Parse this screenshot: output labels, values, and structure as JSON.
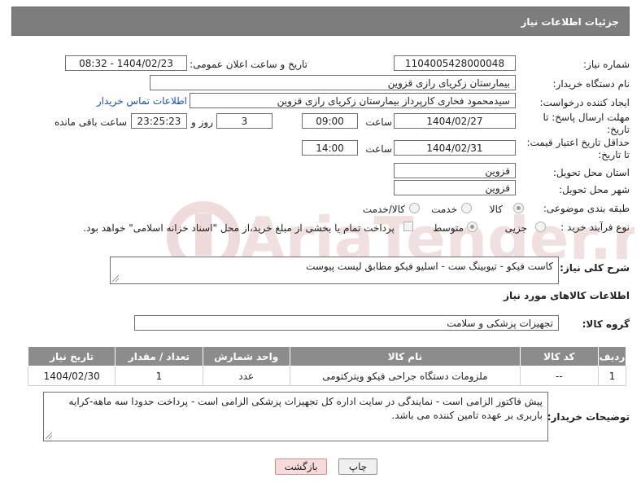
{
  "header": {
    "title": "جزئیات اطلاعات نیاز"
  },
  "fields": {
    "need_number": {
      "label": "شماره نیاز:",
      "value": "1104005428000048"
    },
    "announce_datetime": {
      "label": "تاریخ و ساعت اعلان عمومی:",
      "value": "1404/02/23 - 08:32"
    },
    "buyer_org": {
      "label": "نام دستگاه خریدار:",
      "value": "بیمارستان زکریای رازی قزوین"
    },
    "requester": {
      "label": "ایجاد کننده درخواست:",
      "value": "سیدمحمود فخاری کارپرداز بیمارستان زکریای رازی قزوین"
    },
    "contact_link": "اطلاعات تماس خریدار",
    "reply_deadline": {
      "label_line1": "مهلت ارسال پاسخ: تا",
      "label_line2": "تاریخ:",
      "date": "1404/02/27",
      "time_label": "ساعت",
      "time": "09:00",
      "days": "3",
      "days_label": "روز و",
      "remaining": "23:25:23",
      "remaining_label": "ساعت باقی مانده"
    },
    "price_validity": {
      "label_line1": "حداقل تاریخ اعتبار قیمت:",
      "label_line2": "تا تاریخ:",
      "date": "1404/02/31",
      "time_label": "ساعت",
      "time": "14:00"
    },
    "delivery_province": {
      "label": "استان محل تحویل:",
      "value": "قزوین"
    },
    "delivery_city": {
      "label": "شهر محل تحویل:",
      "value": "قزوین"
    },
    "category": {
      "label": "طبقه بندی موضوعی:",
      "options": [
        "کالا",
        "خدمت",
        "کالا/خدمت"
      ],
      "selected": "کالا"
    },
    "purchase_type": {
      "label": "نوع فرآیند خرید :",
      "options": [
        "جزیی",
        "متوسط"
      ],
      "selected": "متوسط",
      "payment_note": "پرداخت تمام یا بخشی از مبلغ خرید،از محل \"اسناد خزانه اسلامی\" خواهد بود."
    }
  },
  "description": {
    "label": "شرح کلی نیاز:",
    "value": "کاست فیکو - تیوبینگ ست - اسلیو فیکو مطابق لیست پیوست"
  },
  "goods_section": {
    "title": "اطلاعات کالاهای مورد نیاز",
    "group_label": "گروه کالا:",
    "group_value": "تجهیزات پزشکی و سلامت",
    "columns": [
      "ردیف",
      "کد کالا",
      "نام کالا",
      "واحد شمارش",
      "تعداد / مقدار",
      "تاریخ نیاز"
    ],
    "rows": [
      [
        "1",
        "--",
        "ملزومات دستگاه جراحی فیکو ویترکتومی",
        "عدد",
        "1",
        "1404/02/30"
      ]
    ]
  },
  "buyer_notes": {
    "label": "توضیحات خریدار:",
    "value": "پیش فاکتور الزامی است - نمایندگی در سایت اداره کل تجهیزات پزشکی الزامی است - پرداخت حدودا سه ماهه-کرایه باربری بر عهده تامین کننده می باشد."
  },
  "buttons": {
    "print": "چاپ",
    "back": "بازگشت"
  },
  "watermark": {
    "text": "AriaTender.net",
    "color": "#e0b8b8"
  }
}
